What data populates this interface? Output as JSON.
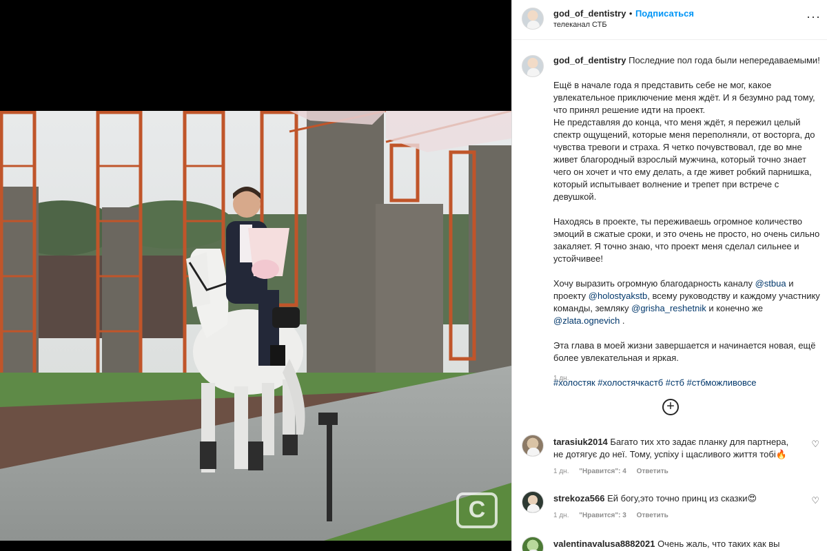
{
  "post": {
    "username": "god_of_dentistry",
    "separator": "•",
    "follow_label": "Подписаться",
    "subtitle": "телеканал СТБ",
    "more_label": "···"
  },
  "caption": {
    "username": "god_of_dentistry",
    "first_line": "Последние пол года были непередаваемыми!",
    "para1": "Ещё в начале года я представить себе не мог, какое увлекательное приключение меня ждёт. И я безумно рад тому, что принял решение идти на проект.\nНе представляя до конца, что меня ждёт, я пережил целый спектр ощущений, которые меня переполняли, от восторга, до чувства тревоги и страха. Я четко почувствовал, где во мне живет благородный взрослый мужчина, который точно знает чего он хочет и что ему делать, а где живет робкий парнишка, который испытывает волнение и трепет при встрече с девушкой.",
    "para2": "Находясь в проекте, ты переживаешь огромное количество эмоций в сжатые сроки, и это очень не просто, но очень сильно закаляет. Я точно знаю, что проект меня сделал сильнее и устойчивее!",
    "thanks_1": "Хочу выразить огромную благодарность каналу ",
    "mention_1": "@stbua",
    "thanks_2": " и проекту ",
    "mention_2": "@holostyakstb",
    "thanks_3": ", всему руководству и каждому участнику команды, земляку ",
    "mention_3": "@grisha_reshetnik",
    "thanks_4": " и конечно же ",
    "mention_4": "@zlata.ognevich",
    "thanks_5": " .",
    "para4": "Эта глава в моей жизни завершается и начинается новая, ещё более увлекательная и яркая.",
    "hashtags": [
      "#холостяк",
      "#холостячкастб",
      "#стб",
      "#стбможливовсе"
    ],
    "time": "1 дн."
  },
  "load_more_icon": "+",
  "comments": [
    {
      "username": "tarasiuk2014",
      "text": "Багато тих хто задає планку для партнера, не дотягує до неї. Тому, успіху і щасливого життя тобі🔥",
      "time": "1 дн.",
      "likes": "\"Нравится\": 4",
      "reply": "Ответить"
    },
    {
      "username": "strekoza566",
      "text": "Ей богу,это точно принц из сказки😍",
      "time": "1 дн.",
      "likes": "\"Нравится\": 3",
      "reply": "Ответить"
    },
    {
      "username": "valentinavalusa8882021",
      "text": "Очень жаль, что таких как вы очень",
      "time": "",
      "likes": "",
      "reply": ""
    }
  ],
  "heart_icon": "♡",
  "watermark": "С"
}
